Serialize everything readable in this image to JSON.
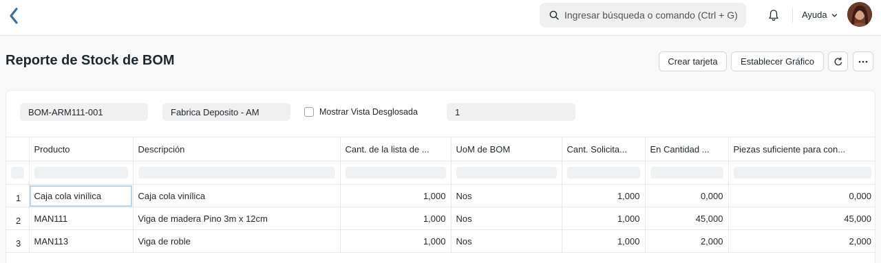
{
  "navbar": {
    "search_placeholder": "Ingresar búsqueda o comando (Ctrl + G)",
    "help_label": "Ayuda"
  },
  "page": {
    "title": "Reporte de Stock de BOM",
    "buttons": {
      "create_card": "Crear tarjeta",
      "set_chart": "Establecer Gráfico"
    }
  },
  "filters": {
    "bom": "BOM-ARM111-001",
    "warehouse": "Fabrica Deposito - AM",
    "show_exploded_label": "Mostrar Vista Desglosada",
    "qty": "1"
  },
  "table": {
    "columns": [
      "Producto",
      "Descripción",
      "Cant. de la lista de ...",
      "UoM de BOM",
      "Cant. Solicita...",
      "En Cantidad ...",
      "Piezas suficiente para con..."
    ],
    "rows": [
      {
        "n": "1",
        "item": "Caja cola vinílica",
        "desc": "Caja cola vinílica",
        "bom_qty": "1,000",
        "uom": "Nos",
        "req_qty": "1,000",
        "in_qty": "0,000",
        "enough": "0,000"
      },
      {
        "n": "2",
        "item": "MAN111",
        "desc": "Viga de madera Pino 3m x 12cm",
        "bom_qty": "1,000",
        "uom": "Nos",
        "req_qty": "1,000",
        "in_qty": "45,000",
        "enough": "45,000"
      },
      {
        "n": "3",
        "item": "MAN113",
        "desc": "Viga de roble",
        "bom_qty": "1,000",
        "uom": "Nos",
        "req_qty": "1,000",
        "in_qty": "2,000",
        "enough": "2,000"
      }
    ]
  },
  "colors": {
    "accent": "#2490ef",
    "logo": "#3b6f9b"
  }
}
